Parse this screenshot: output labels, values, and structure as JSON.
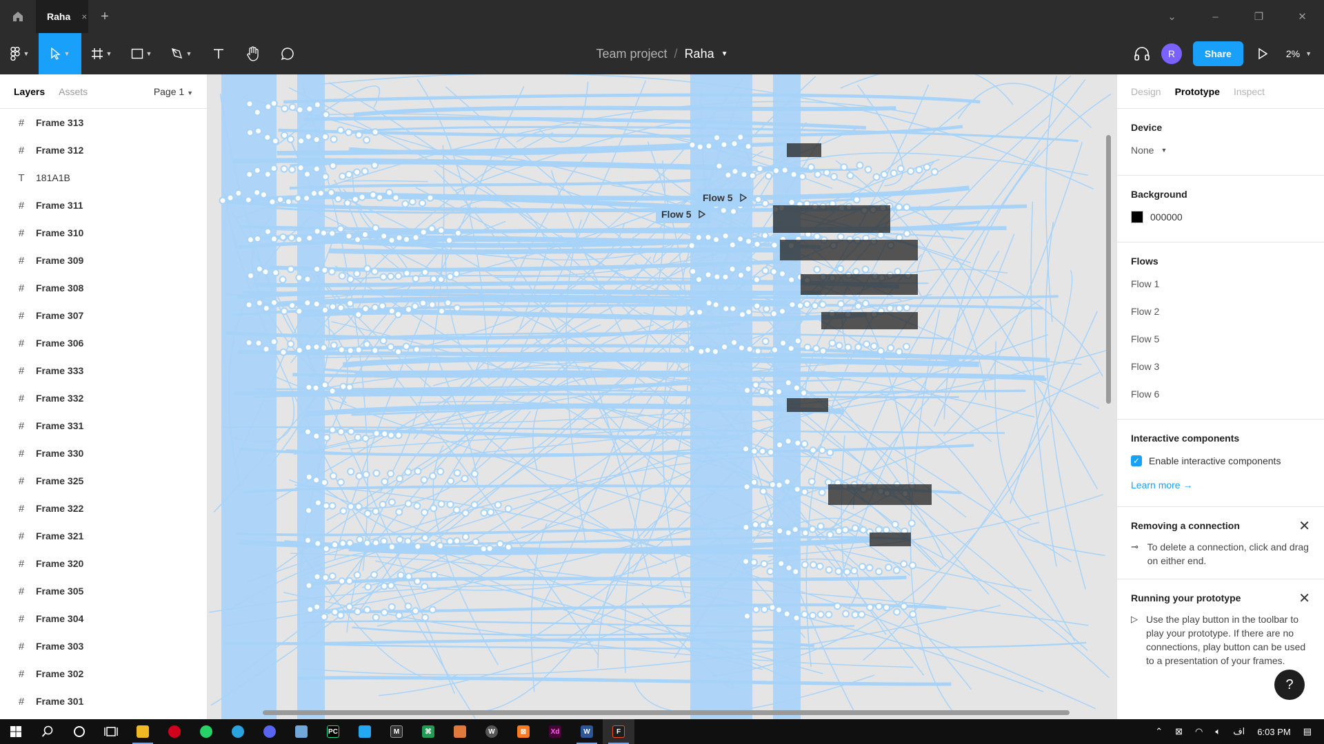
{
  "titlebar": {
    "tab_title": "Raha",
    "tab_close": "×",
    "new_tab": "+",
    "window_controls": [
      "⌄",
      "–",
      "❐",
      "✕"
    ]
  },
  "toolbar": {
    "team": "Team project",
    "separator": "/",
    "file_name": "Raha",
    "avatar_initial": "R",
    "share_label": "Share",
    "zoom": "2%"
  },
  "left_panel": {
    "tabs": [
      "Layers",
      "Assets"
    ],
    "page_select": "Page 1",
    "layers": [
      {
        "type": "frame",
        "name": "Frame 313"
      },
      {
        "type": "frame",
        "name": "Frame 312"
      },
      {
        "type": "text",
        "name": "181A1B"
      },
      {
        "type": "frame",
        "name": "Frame 311"
      },
      {
        "type": "frame",
        "name": "Frame 310"
      },
      {
        "type": "frame",
        "name": "Frame 309"
      },
      {
        "type": "frame",
        "name": "Frame 308"
      },
      {
        "type": "frame",
        "name": "Frame 307"
      },
      {
        "type": "frame",
        "name": "Frame 306"
      },
      {
        "type": "frame",
        "name": "Frame 333"
      },
      {
        "type": "frame",
        "name": "Frame 332"
      },
      {
        "type": "frame",
        "name": "Frame 331"
      },
      {
        "type": "frame",
        "name": "Frame 330"
      },
      {
        "type": "frame",
        "name": "Frame 325"
      },
      {
        "type": "frame",
        "name": "Frame 322"
      },
      {
        "type": "frame",
        "name": "Frame 321"
      },
      {
        "type": "frame",
        "name": "Frame 320"
      },
      {
        "type": "frame",
        "name": "Frame 305"
      },
      {
        "type": "frame",
        "name": "Frame 304"
      },
      {
        "type": "frame",
        "name": "Frame 303"
      },
      {
        "type": "frame",
        "name": "Frame 302"
      },
      {
        "type": "frame",
        "name": "Frame 301"
      }
    ]
  },
  "canvas": {
    "flow_badges": [
      "Flow 5",
      "Flow 5"
    ],
    "connection_color": "#a7d3f8"
  },
  "right_panel": {
    "tabs": [
      "Design",
      "Prototype",
      "Inspect"
    ],
    "device_title": "Device",
    "device_value": "None",
    "background_title": "Background",
    "background_hex": "000000",
    "flows_title": "Flows",
    "flows": [
      "Flow 1",
      "Flow 2",
      "Flow 5",
      "Flow 3",
      "Flow 6"
    ],
    "interactive_title": "Interactive components",
    "interactive_checkbox_label": "Enable interactive components",
    "learn_more": "Learn more →",
    "tip1_title": "Removing a connection",
    "tip1_body": "To delete a connection, click and drag on either end.",
    "tip2_title": "Running your prototype",
    "tip2_body": "Use the play button in the toolbar to play your prototype. If there are no connections, play button can be used to a presentation of your frames.",
    "help": "?"
  },
  "taskbar": {
    "time": "6:03 PM",
    "lang": "اف"
  },
  "colors": {
    "accent": "#18a0fb",
    "chrome": "#2c2c2c",
    "canvas": "#e5e5e5"
  }
}
